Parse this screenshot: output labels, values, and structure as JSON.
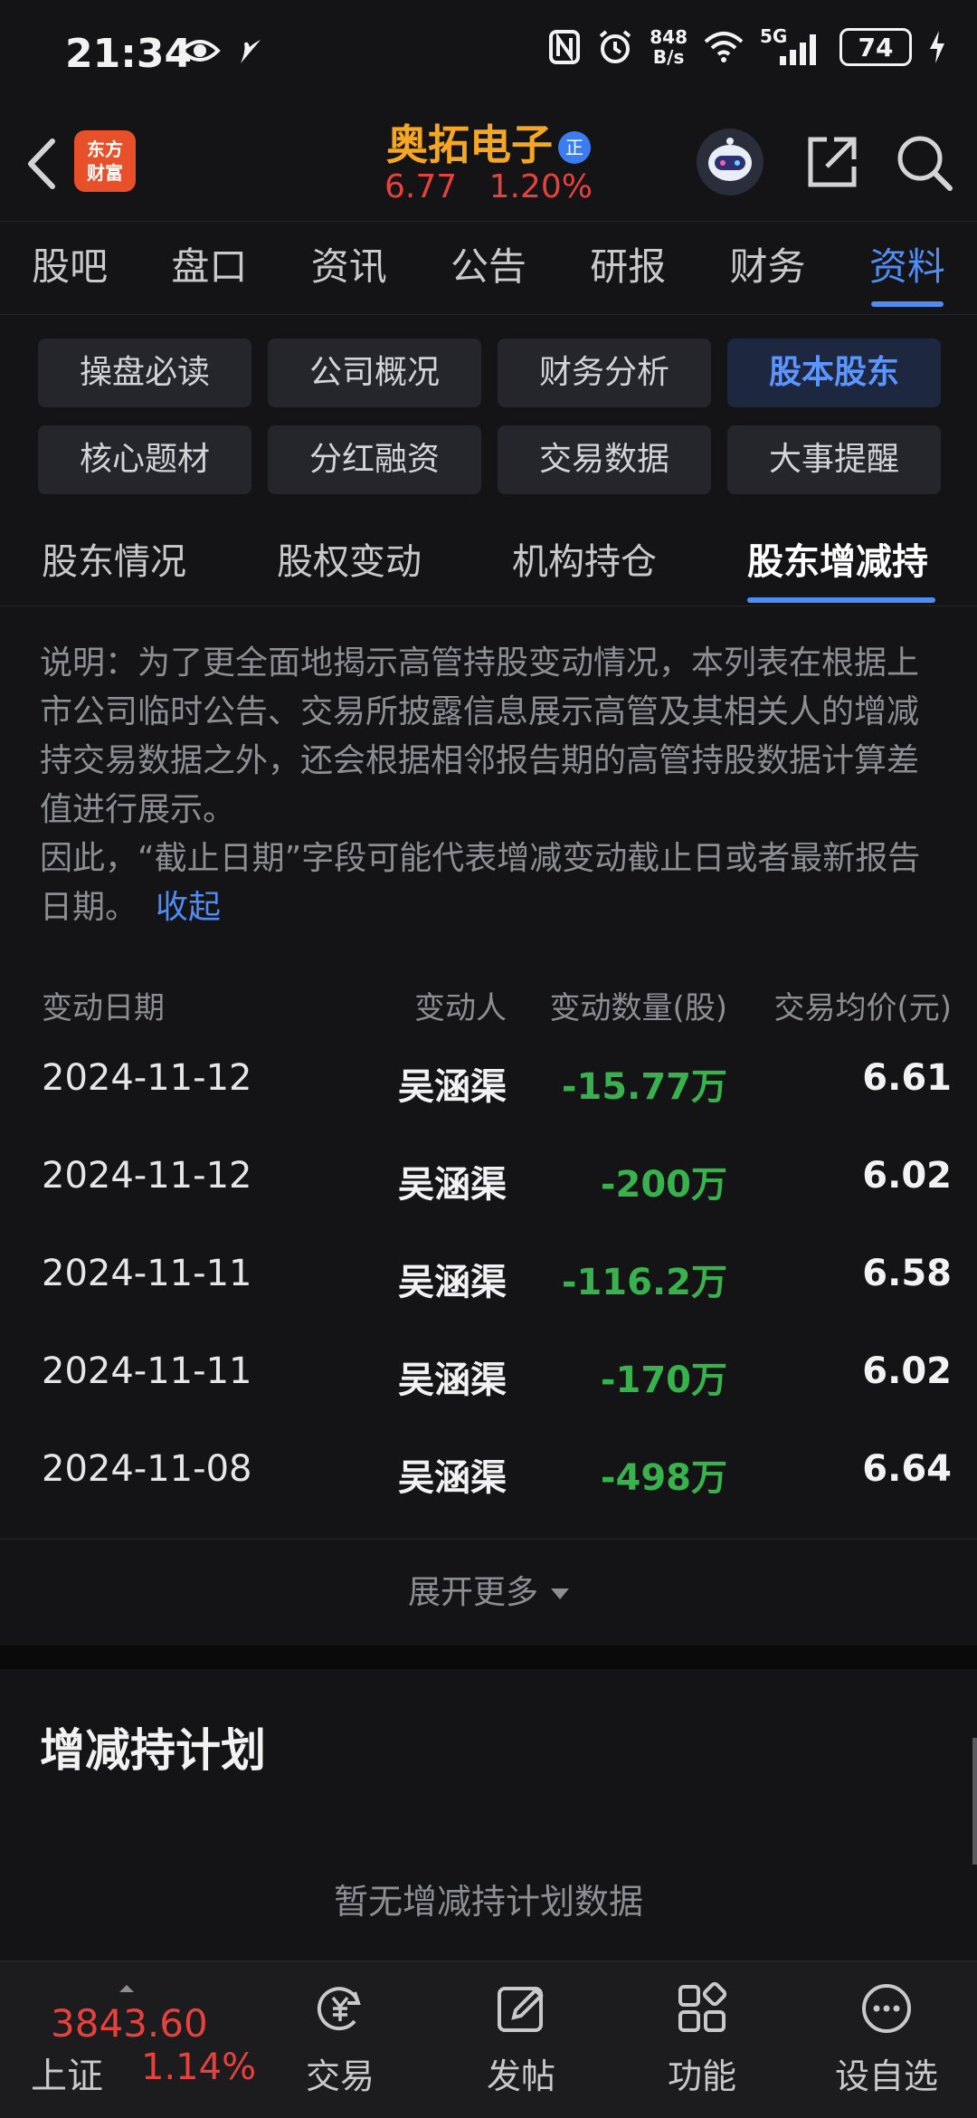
{
  "status_bar": {
    "time": "21:34",
    "network_speed_value": "848",
    "network_speed_unit": "B/s",
    "signal_label": "5G",
    "battery": "74",
    "icons": [
      "eye-icon",
      "feather-icon",
      "nfc-icon",
      "alarm-icon",
      "wifi-icon",
      "signal-icon",
      "charging-icon"
    ]
  },
  "header": {
    "brand_logo_line1": "东方",
    "brand_logo_line2": "财富",
    "stock_name": "奥拓电子",
    "stock_badge": "正",
    "price": "6.77",
    "change_percent": "1.20%",
    "accent_color": "#f5a623",
    "up_color": "#e7413d"
  },
  "main_tabs": [
    {
      "label": "股吧",
      "active": false
    },
    {
      "label": "盘口",
      "active": false
    },
    {
      "label": "资讯",
      "active": false
    },
    {
      "label": "公告",
      "active": false
    },
    {
      "label": "研报",
      "active": false
    },
    {
      "label": "财务",
      "active": false
    },
    {
      "label": "资料",
      "active": true
    }
  ],
  "categories": [
    {
      "label": "操盘必读",
      "active": false
    },
    {
      "label": "公司概况",
      "active": false
    },
    {
      "label": "财务分析",
      "active": false
    },
    {
      "label": "股本股东",
      "active": true
    },
    {
      "label": "核心题材",
      "active": false
    },
    {
      "label": "分红融资",
      "active": false
    },
    {
      "label": "交易数据",
      "active": false
    },
    {
      "label": "大事提醒",
      "active": false
    }
  ],
  "sub_tabs": [
    {
      "label": "股东情况",
      "active": false
    },
    {
      "label": "股权变动",
      "active": false
    },
    {
      "label": "机构持仓",
      "active": false
    },
    {
      "label": "股东增减持",
      "active": true
    }
  ],
  "note": {
    "paragraph1": "说明：为了更全面地揭示高管持股变动情况，本列表在根据上市公司临时公告、交易所披露信息展示高管及其相关人的增减持交易数据之外，还会根据相邻报告期的高管持股数据计算差值进行展示。",
    "paragraph2": "因此，“截止日期”字段可能代表增减变动截止日或者最新报告日期。",
    "collapse_label": "收起"
  },
  "table": {
    "headers": {
      "date": "变动日期",
      "person": "变动人",
      "quantity": "变动数量(股)",
      "price": "交易均价(元)"
    },
    "rows": [
      {
        "date": "2024-11-12",
        "person": "吴涵渠",
        "quantity": "-15.77万",
        "price": "6.61"
      },
      {
        "date": "2024-11-12",
        "person": "吴涵渠",
        "quantity": "-200万",
        "price": "6.02"
      },
      {
        "date": "2024-11-11",
        "person": "吴涵渠",
        "quantity": "-116.2万",
        "price": "6.58"
      },
      {
        "date": "2024-11-11",
        "person": "吴涵渠",
        "quantity": "-170万",
        "price": "6.02"
      },
      {
        "date": "2024-11-08",
        "person": "吴涵渠",
        "quantity": "-498万",
        "price": "6.64"
      }
    ],
    "decrease_color": "#37b24d"
  },
  "expand_label": "展开更多",
  "plan_section": {
    "title": "增减持计划",
    "empty_text": "暂无增减持计划数据"
  },
  "bottom_bar": {
    "index_value": "3843.60",
    "index_name": "上证",
    "index_change": "1.14%",
    "nav": [
      {
        "label": "交易",
        "icon": "yen-exchange-icon"
      },
      {
        "label": "发帖",
        "icon": "compose-icon"
      },
      {
        "label": "功能",
        "icon": "grid-icon"
      },
      {
        "label": "设自选",
        "icon": "more-dots-icon"
      }
    ]
  }
}
